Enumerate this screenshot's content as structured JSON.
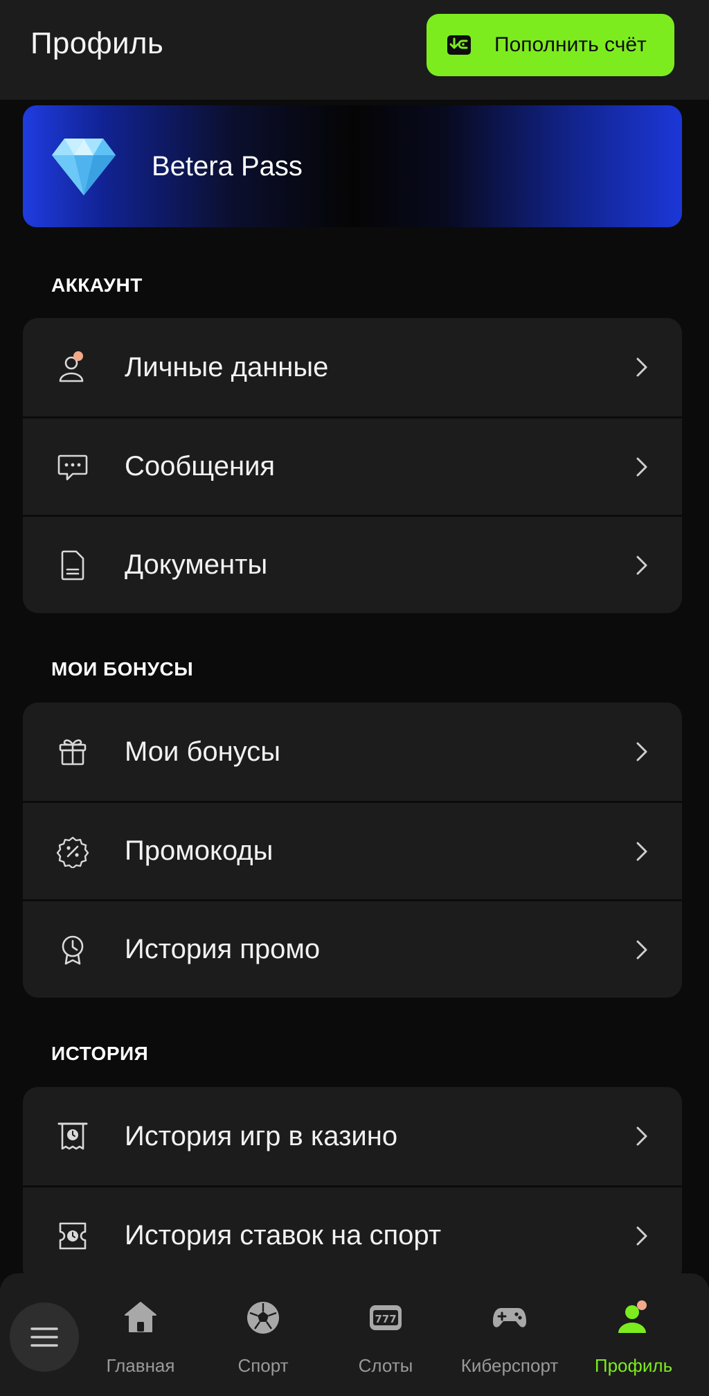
{
  "header": {
    "title": "Профиль",
    "topup_label": "Пополнить счёт"
  },
  "pass_card": {
    "title": "Betera Pass"
  },
  "sections": {
    "account": {
      "title": "АККАУНТ",
      "items": [
        {
          "label": "Личные данные",
          "icon": "user-icon"
        },
        {
          "label": "Сообщения",
          "icon": "chat-icon"
        },
        {
          "label": "Документы",
          "icon": "document-icon"
        }
      ]
    },
    "bonuses": {
      "title": "МОИ БОНУСЫ",
      "items": [
        {
          "label": "Мои бонусы",
          "icon": "gift-icon"
        },
        {
          "label": "Промокоды",
          "icon": "promo-code-icon"
        },
        {
          "label": "История промо",
          "icon": "promo-history-icon"
        }
      ]
    },
    "history": {
      "title": "ИСТОРИЯ",
      "items": [
        {
          "label": "История игр в казино",
          "icon": "casino-history-icon"
        },
        {
          "label": "История ставок на спорт",
          "icon": "sport-bets-history-icon"
        }
      ]
    }
  },
  "bottom_nav": {
    "items": [
      {
        "label": "Главная",
        "icon": "home-icon"
      },
      {
        "label": "Спорт",
        "icon": "soccer-ball-icon"
      },
      {
        "label": "Слоты",
        "icon": "slots-777-icon"
      },
      {
        "label": "Киберспорт",
        "icon": "gamepad-icon"
      },
      {
        "label": "Профиль",
        "icon": "profile-icon",
        "active": true
      }
    ]
  },
  "colors": {
    "accent": "#7dec1f",
    "background": "#0b0b0b",
    "card": "#1c1c1c",
    "notification_dot": "#f2a98a",
    "pass_blue": "#1c37d8"
  }
}
